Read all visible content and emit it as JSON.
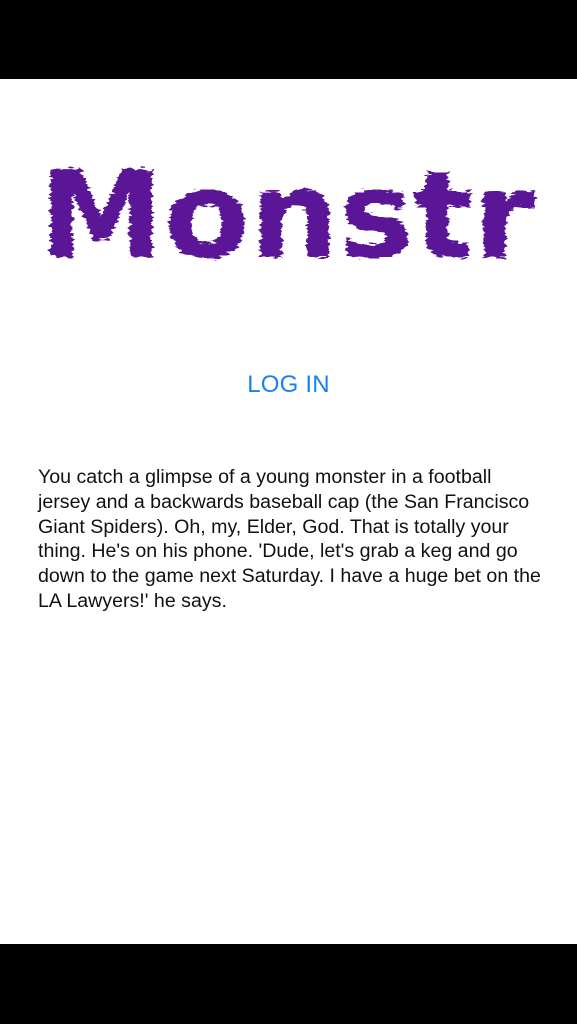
{
  "app": {
    "logo_text": "Monstr",
    "logo_color": "#5a1796"
  },
  "auth": {
    "login_label": "LOG IN",
    "link_color": "#1a82f0"
  },
  "story": {
    "text": "You catch a glimpse of a young monster in a football jersey and a backwards baseball cap (the San Francisco Giant Spiders). Oh, my, Elder, God. That is totally your thing. He's on his phone. 'Dude, let's grab a keg and go down to the game next Saturday. I have a huge bet on the LA Lawyers!' he says."
  }
}
